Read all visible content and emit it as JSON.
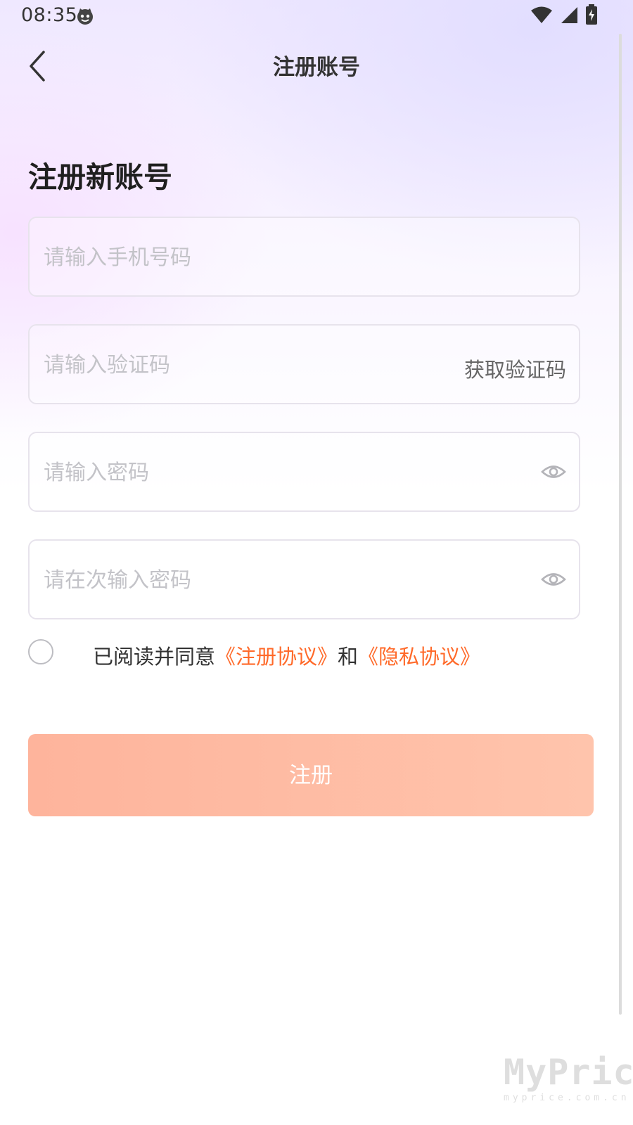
{
  "status_bar": {
    "time": "08:35",
    "icons": [
      "cat-face-icon",
      "wifi-icon",
      "signal-icon",
      "battery-charging-icon"
    ]
  },
  "header": {
    "title": "注册账号",
    "back_icon": "chevron-left-icon"
  },
  "main": {
    "heading": "注册新账号",
    "fields": {
      "phone": {
        "placeholder": "请输入手机号码",
        "value": ""
      },
      "code": {
        "placeholder": "请输入验证码",
        "value": "",
        "action_label": "获取验证码"
      },
      "password": {
        "placeholder": "请输入密码",
        "value": "",
        "toggle_icon": "eye-icon"
      },
      "confirm_password": {
        "placeholder": "请在次输入密码",
        "value": "",
        "toggle_icon": "eye-icon"
      }
    },
    "agreement": {
      "checked": false,
      "prefix": "已阅读并同意",
      "link1": "《注册协议》",
      "middle": "和",
      "link2": "《隐私协议》"
    },
    "submit_label": "注册"
  },
  "watermark": {
    "brand": "MyPrice",
    "url": "myprice.com.cn"
  },
  "colors": {
    "accent_link": "#ff6a2a",
    "button_bg": "#feb49c",
    "placeholder": "#c3c3c8"
  }
}
